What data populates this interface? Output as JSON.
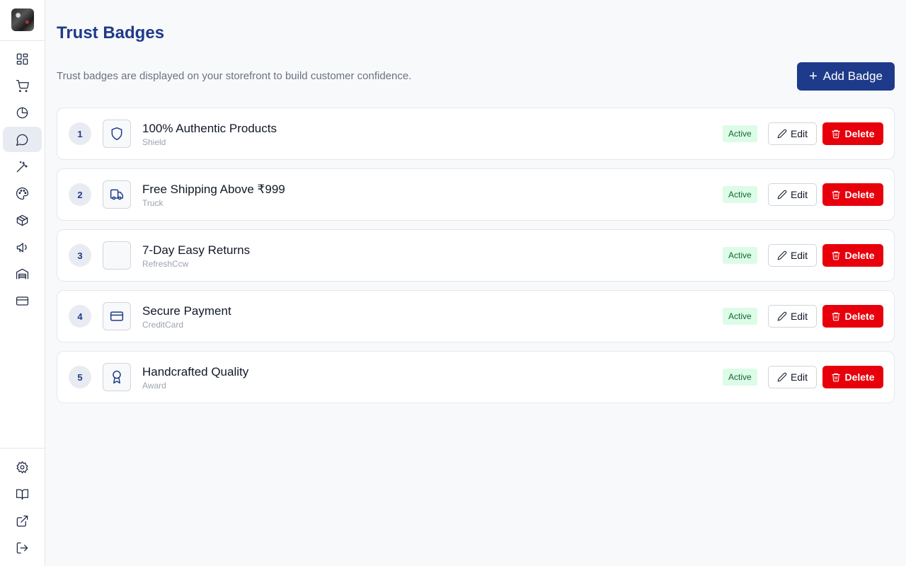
{
  "sidebar": {
    "logo": "store-logo",
    "items": [
      {
        "name": "dashboard-icon",
        "active": false
      },
      {
        "name": "cart-icon",
        "active": false
      },
      {
        "name": "pie-chart-icon",
        "active": false
      },
      {
        "name": "message-circle-icon",
        "active": true
      },
      {
        "name": "wand-icon",
        "active": false
      },
      {
        "name": "palette-icon",
        "active": false
      },
      {
        "name": "package-icon",
        "active": false
      },
      {
        "name": "megaphone-icon",
        "active": false
      },
      {
        "name": "warehouse-icon",
        "active": false
      },
      {
        "name": "credit-card-icon",
        "active": false
      }
    ],
    "bottom_items": [
      {
        "name": "settings-icon"
      },
      {
        "name": "book-open-icon"
      },
      {
        "name": "external-link-icon"
      },
      {
        "name": "logout-icon"
      }
    ]
  },
  "header": {
    "title": "Trust Badges",
    "description": "Trust badges are displayed on your storefront to build customer confidence.",
    "add_button": "Add Badge"
  },
  "badges": [
    {
      "order": "1",
      "title": "100% Authentic Products",
      "icon_name": "Shield",
      "status": "Active",
      "edit_label": "Edit",
      "delete_label": "Delete"
    },
    {
      "order": "2",
      "title": "Free Shipping Above ₹999",
      "icon_name": "Truck",
      "status": "Active",
      "edit_label": "Edit",
      "delete_label": "Delete"
    },
    {
      "order": "3",
      "title": "7-Day Easy Returns",
      "icon_name": "RefreshCcw",
      "status": "Active",
      "edit_label": "Edit",
      "delete_label": "Delete"
    },
    {
      "order": "4",
      "title": "Secure Payment",
      "icon_name": "CreditCard",
      "status": "Active",
      "edit_label": "Edit",
      "delete_label": "Delete"
    },
    {
      "order": "5",
      "title": "Handcrafted Quality",
      "icon_name": "Award",
      "status": "Active",
      "edit_label": "Edit",
      "delete_label": "Delete"
    }
  ],
  "colors": {
    "accent": "#1e3a8a",
    "danger": "#e7000b",
    "success_bg": "#dcfce7",
    "success_text": "#166534"
  }
}
